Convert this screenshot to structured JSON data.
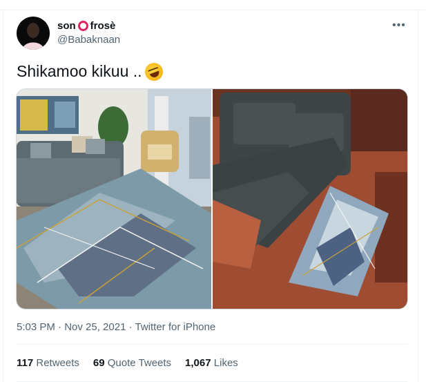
{
  "tweet": {
    "display_name_part1": "son",
    "display_name_part2": "frosè",
    "handle": "@Babaknaan",
    "text": "Shikamoo kikuu ..",
    "emoji": "rolling-on-floor-laughing",
    "timestamp": "5:03 PM · Nov 25, 2021 · Twitter for iPhone"
  },
  "stats": {
    "retweets_count": "117",
    "retweets_label": "Retweets",
    "quotes_count": "69",
    "quotes_label": "Quote Tweets",
    "likes_count": "1,067",
    "likes_label": "Likes"
  },
  "media": {
    "left_photo": "living room sofa with marble rug",
    "right_photo": "grey sofa with small marble rug on red floor"
  },
  "colors": {
    "text_primary": "#0f1419",
    "text_secondary": "#536471",
    "ring_accent": "#e0245e"
  }
}
